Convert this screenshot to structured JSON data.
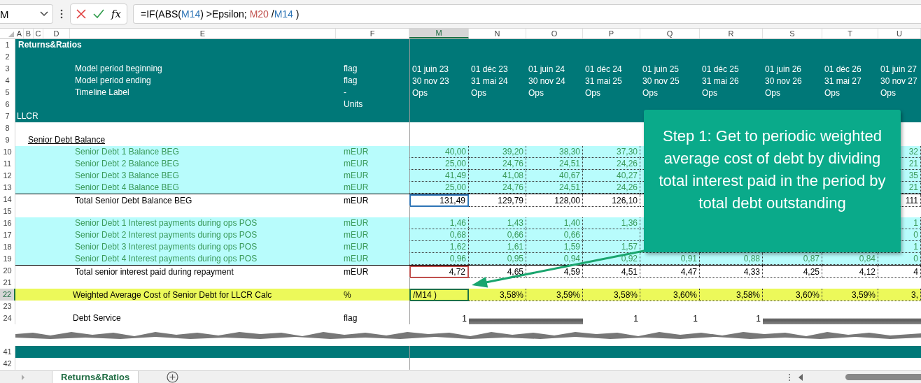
{
  "formula_bar": {
    "name_box": "M",
    "function_label": "fx",
    "formula": [
      {
        "text": "=IF(ABS("
      },
      {
        "text": "M14",
        "color": "#2e75b6"
      },
      {
        "text": ") >Epsilon; "
      },
      {
        "text": "M20",
        "color": "#c0504d"
      },
      {
        "text": " /"
      },
      {
        "text": "M14",
        "color": "#2e75b6"
      },
      {
        "text": " )"
      }
    ]
  },
  "columns": [
    {
      "label": "A",
      "selected": false
    },
    {
      "label": "B",
      "selected": false
    },
    {
      "label": "C",
      "selected": false
    },
    {
      "label": "D",
      "selected": false
    },
    {
      "label": "E",
      "selected": false
    },
    {
      "label": "F",
      "selected": false
    },
    {
      "label": "M",
      "selected": true
    },
    {
      "label": "N",
      "selected": false
    },
    {
      "label": "O",
      "selected": false
    },
    {
      "label": "P",
      "selected": false
    },
    {
      "label": "Q",
      "selected": false
    },
    {
      "label": "R",
      "selected": false
    },
    {
      "label": "S",
      "selected": false
    },
    {
      "label": "T",
      "selected": false
    },
    {
      "label": "U",
      "selected": false
    }
  ],
  "rows": [
    {
      "num": "1",
      "selected": false,
      "kind": "title",
      "label": "Returns&Ratios"
    },
    {
      "num": "2",
      "selected": false,
      "kind": "band"
    },
    {
      "num": "3",
      "selected": false,
      "kind": "band",
      "label": "Model period beginning",
      "unit": "flag",
      "values": [
        "01 juin 23",
        "01 déc 23",
        "01 juin 24",
        "01 déc 24",
        "01 juin 25",
        "01 déc 25",
        "01 juin 26",
        "01 déc 26",
        "01 juin 27"
      ]
    },
    {
      "num": "4",
      "selected": false,
      "kind": "band",
      "label": "Model period ending",
      "unit": "flag",
      "values": [
        "30 nov 23",
        "31 mai 24",
        "30 nov 24",
        "31 mai 25",
        "30 nov 25",
        "31 mai 26",
        "30 nov 26",
        "31 mai 27",
        "30 nov 27"
      ]
    },
    {
      "num": "5",
      "selected": false,
      "kind": "band",
      "label": "Timeline Label",
      "unit": "-",
      "values": [
        "Ops",
        "Ops",
        "Ops",
        "Ops",
        "Ops",
        "Ops",
        "Ops",
        "Ops",
        "Ops"
      ]
    },
    {
      "num": "6",
      "selected": false,
      "kind": "band",
      "unit": "Units"
    },
    {
      "num": "7",
      "selected": false,
      "kind": "note",
      "label": "LLCR"
    },
    {
      "num": "8",
      "selected": false,
      "kind": "blank"
    },
    {
      "num": "9",
      "selected": false,
      "kind": "section",
      "label": "Senior Debt Balance"
    },
    {
      "num": "10",
      "selected": false,
      "kind": "input",
      "label": "Senior Debt 1 Balance BEG",
      "unit": "mEUR",
      "values": [
        "40,00",
        "39,20",
        "38,30",
        "37,30"
      ],
      "u_value": "32"
    },
    {
      "num": "11",
      "selected": false,
      "kind": "input",
      "label": "Senior Debt 2 Balance BEG",
      "unit": "mEUR",
      "values": [
        "25,00",
        "24,76",
        "24,51",
        "24,26"
      ],
      "u_value": "21"
    },
    {
      "num": "12",
      "selected": false,
      "kind": "input",
      "label": "Senior Debt 3 Balance BEG",
      "unit": "mEUR",
      "values": [
        "41,49",
        "41,08",
        "40,67",
        "40,27"
      ],
      "u_value": "35"
    },
    {
      "num": "13",
      "selected": false,
      "kind": "input",
      "label": "Senior Debt 4 Balance BEG",
      "unit": "mEUR",
      "values": [
        "25,00",
        "24,76",
        "24,51",
        "24,26"
      ],
      "u_value": "21"
    },
    {
      "num": "14",
      "selected": false,
      "kind": "total",
      "label": "Total Senior Debt Balance BEG",
      "unit": "mEUR",
      "color": "#2e75b6",
      "values": [
        "131,49",
        "129,79",
        "128,00",
        "126,10"
      ],
      "u_value": "111"
    },
    {
      "num": "15",
      "selected": false,
      "kind": "blank"
    },
    {
      "num": "16",
      "selected": false,
      "kind": "input",
      "label": "Senior Debt 1 Interest payments during ops POS",
      "unit": "mEUR",
      "values": [
        "1,46",
        "1,43",
        "1,40",
        "1,36"
      ],
      "u_value": "1"
    },
    {
      "num": "17",
      "selected": false,
      "kind": "input",
      "label": "Senior Debt 2 Interest payments during ops POS",
      "unit": "mEUR",
      "values": [
        "0,68",
        "0,66",
        "0,66"
      ],
      "u_value": "0"
    },
    {
      "num": "18",
      "selected": false,
      "kind": "input",
      "label": "Senior Debt 3 Interest payments during ops POS",
      "unit": "mEUR",
      "values": [
        "1,62",
        "1,61",
        "1,59",
        "1,57"
      ],
      "u_value": "1"
    },
    {
      "num": "19",
      "selected": false,
      "kind": "input",
      "label": "Senior Debt 4 Interest payments during ops POS",
      "unit": "mEUR",
      "values": [
        "0,96",
        "0,95",
        "0,94",
        "0,92",
        "0,91",
        "0,88",
        "0,87",
        "0,84",
        "0"
      ]
    },
    {
      "num": "20",
      "selected": false,
      "kind": "total",
      "label": "Total senior interest paid during repayment",
      "unit": "mEUR",
      "color": "#c0504d",
      "values": [
        "4,72",
        "4,65",
        "4,59",
        "4,51",
        "4,47",
        "4,33",
        "4,25",
        "4,12",
        "4"
      ]
    },
    {
      "num": "21",
      "selected": false,
      "kind": "blank"
    },
    {
      "num": "22",
      "selected": true,
      "kind": "highlight",
      "label": "Weighted Average Cost of Senior Debt for LLCR Calc",
      "unit": "%",
      "active": true,
      "values": [
        "/M14 )",
        "3,58%",
        "3,59%",
        "3,58%",
        "3,60%",
        "3,58%",
        "3,60%",
        "3,59%",
        "3,"
      ]
    },
    {
      "num": "23",
      "selected": false,
      "kind": "blank"
    },
    {
      "num": "24",
      "selected": false,
      "kind": "plain",
      "label": "Debt Service",
      "unit": "flag",
      "values": [
        "1",
        {
          "shaded": true
        },
        {
          "shaded": true
        },
        "1",
        "1",
        "1",
        {
          "shaded": true
        },
        {
          "shaded": true
        },
        {
          "shaded": true
        }
      ]
    },
    {
      "num": "41",
      "selected": false,
      "kind": "band",
      "tear_before": true
    },
    {
      "num": "42",
      "selected": false,
      "kind": "blank"
    }
  ],
  "callout": "Step 1: Get to periodic weighted average cost of debt by dividing total interest paid in the period by total debt outstanding",
  "sheet_tabs": [
    {
      "label": "Returns&Ratios",
      "selected": true
    }
  ]
}
